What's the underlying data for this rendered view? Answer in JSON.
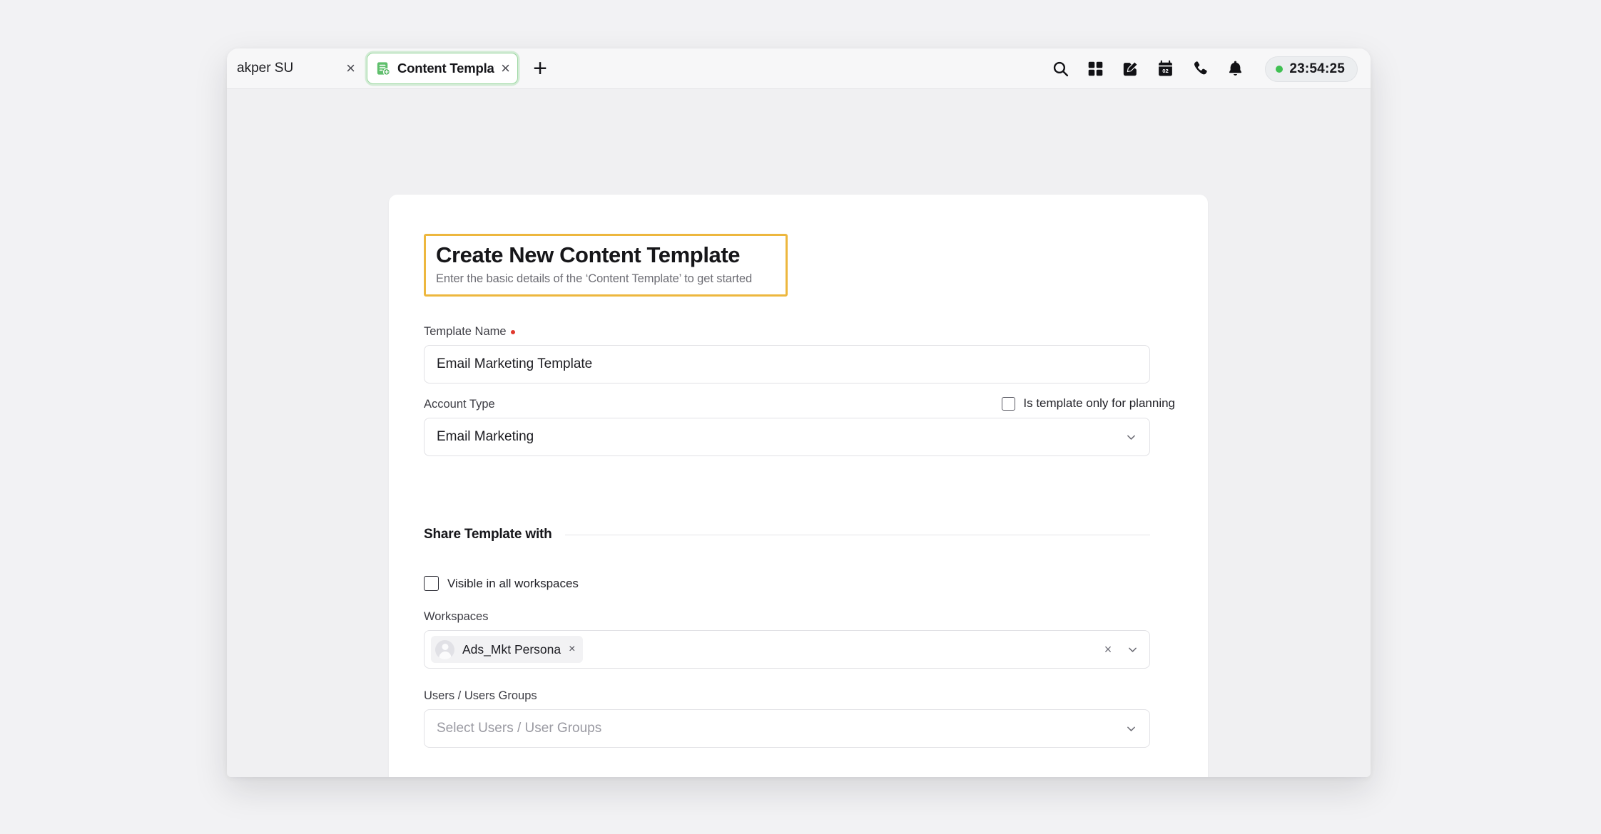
{
  "browser": {
    "tabs": [
      {
        "title": "akper SU",
        "active": false,
        "close_label": "×",
        "favicon": ""
      },
      {
        "title": "Content Template Build",
        "active": true,
        "close_label": "×",
        "favicon": "content-template-icon"
      }
    ],
    "new_tab_label": "+",
    "toolbar_icons": [
      "search-icon",
      "apps-grid-icon",
      "compose-edit-icon",
      "calendar-icon",
      "phone-icon",
      "bell-notification-icon"
    ],
    "clock": {
      "time": "23:54:25",
      "status_color": "#3fc052"
    }
  },
  "page": {
    "title": "Create New Content Template",
    "subtitle": "Enter the basic details of the ‘Content Template’ to get started",
    "highlight_color": "#edb73e"
  },
  "form": {
    "template_name": {
      "label": "Template Name",
      "required": true,
      "value": "Email Marketing Template"
    },
    "account_type": {
      "label": "Account Type",
      "value": "Email Marketing",
      "chevron": "chevron-down-icon"
    },
    "planning_checkbox": {
      "label": "Is template only for planning",
      "checked": false
    }
  },
  "share": {
    "heading": "Share Template with",
    "visible_all_workspaces": {
      "label": "Visible in all workspaces",
      "checked": false
    },
    "workspaces": {
      "label": "Workspaces",
      "chips": [
        {
          "name": "Ads_Mkt Persona",
          "remove_label": "×",
          "avatar": "user-avatar"
        }
      ],
      "clear_label": "×",
      "chevron": "chevron-down-icon"
    },
    "users_groups": {
      "label": "Users / Users Groups",
      "placeholder": "Select Users / User Groups",
      "value": "",
      "chevron": "chevron-down-icon"
    }
  }
}
